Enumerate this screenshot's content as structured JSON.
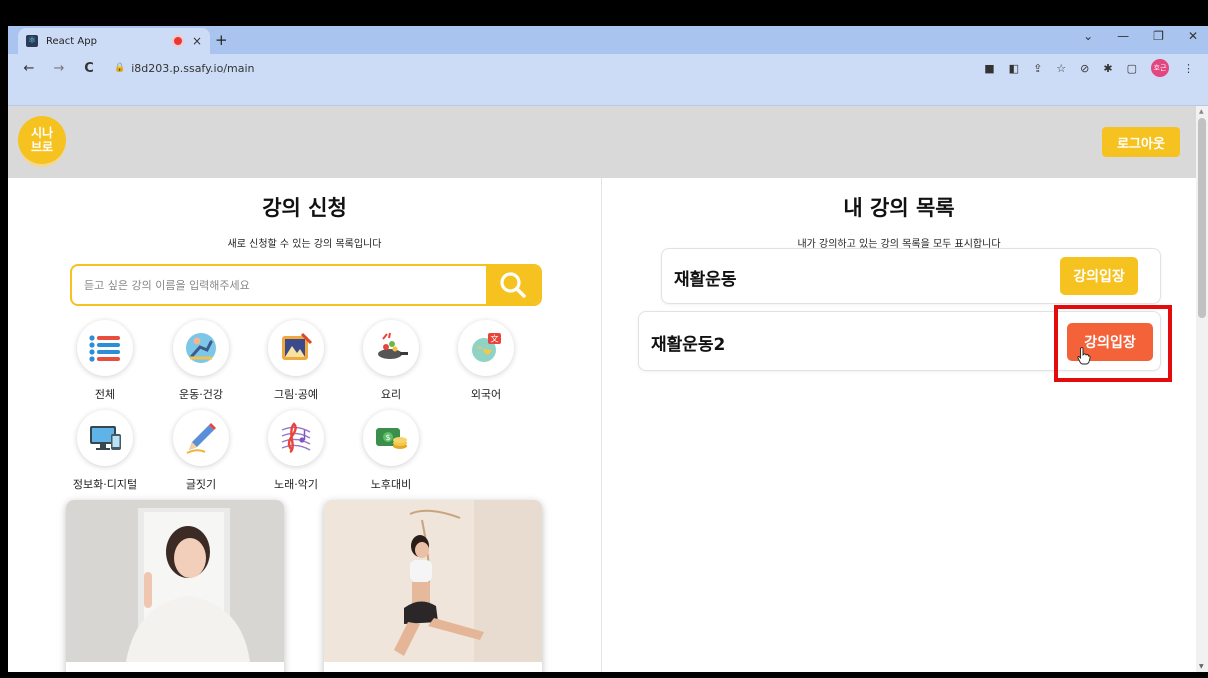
{
  "browser": {
    "tab_title": "React App",
    "tab_close": "×",
    "new_tab": "+",
    "back": "←",
    "forward": "→",
    "reload": "C",
    "url": "i8d203.p.ssafy.io/main",
    "profile_initials": "호근",
    "window_controls": {
      "minimize": "—",
      "maximize": "❐",
      "close": "✕",
      "tab_list": "⌄"
    }
  },
  "header": {
    "logo_text": "시나\n브로",
    "logout_label": "로그아웃"
  },
  "apply": {
    "title": "강의 신청",
    "subtitle": "새로 신청할 수 있는 강의 목록입니다",
    "search_placeholder": "듣고 싶은 강의 이름을 입력해주세요",
    "categories": [
      {
        "label": "전체",
        "icon": "list-icon"
      },
      {
        "label": "운동·건강",
        "icon": "exercise-icon"
      },
      {
        "label": "그림·공예",
        "icon": "painting-icon"
      },
      {
        "label": "요리",
        "icon": "cooking-icon"
      },
      {
        "label": "외국어",
        "icon": "language-icon"
      },
      {
        "label": "정보화·디지털",
        "icon": "computer-icon"
      },
      {
        "label": "글짓기",
        "icon": "pen-icon"
      },
      {
        "label": "노래·악기",
        "icon": "music-icon"
      },
      {
        "label": "노후대비",
        "icon": "money-icon"
      }
    ]
  },
  "my_lectures": {
    "title": "내 강의 목록",
    "subtitle": "내가 강의하고 있는 강의 목록을 모두 표시합니다",
    "items": [
      {
        "name": "재활운동",
        "button": "강의입장"
      },
      {
        "name": "재활운동2",
        "button": "강의입장"
      }
    ]
  },
  "colors": {
    "accent": "#f6c21f",
    "enter_active": "#f4623a",
    "highlight": "#e30b0b",
    "header_bg": "#d9d9d9"
  }
}
